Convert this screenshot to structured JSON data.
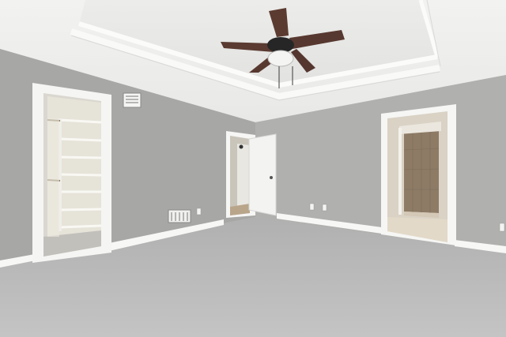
{
  "scene": {
    "subject": "empty-bedroom-interior",
    "features": [
      "tray-ceiling",
      "ceiling-fan",
      "walk-in-closet",
      "bathroom-doorway",
      "hallway-door",
      "carpet-floor"
    ]
  },
  "colors": {
    "wall": "#a9a9a7",
    "wall_light": "#b5b5b3",
    "ceiling": "#eeeeec",
    "trim": "#f7f7f5",
    "carpet": "#bcbcbc",
    "fan_blade": "#5a3a30",
    "fan_body": "#2a2a2a",
    "shower_tile": "#8d7b66"
  }
}
